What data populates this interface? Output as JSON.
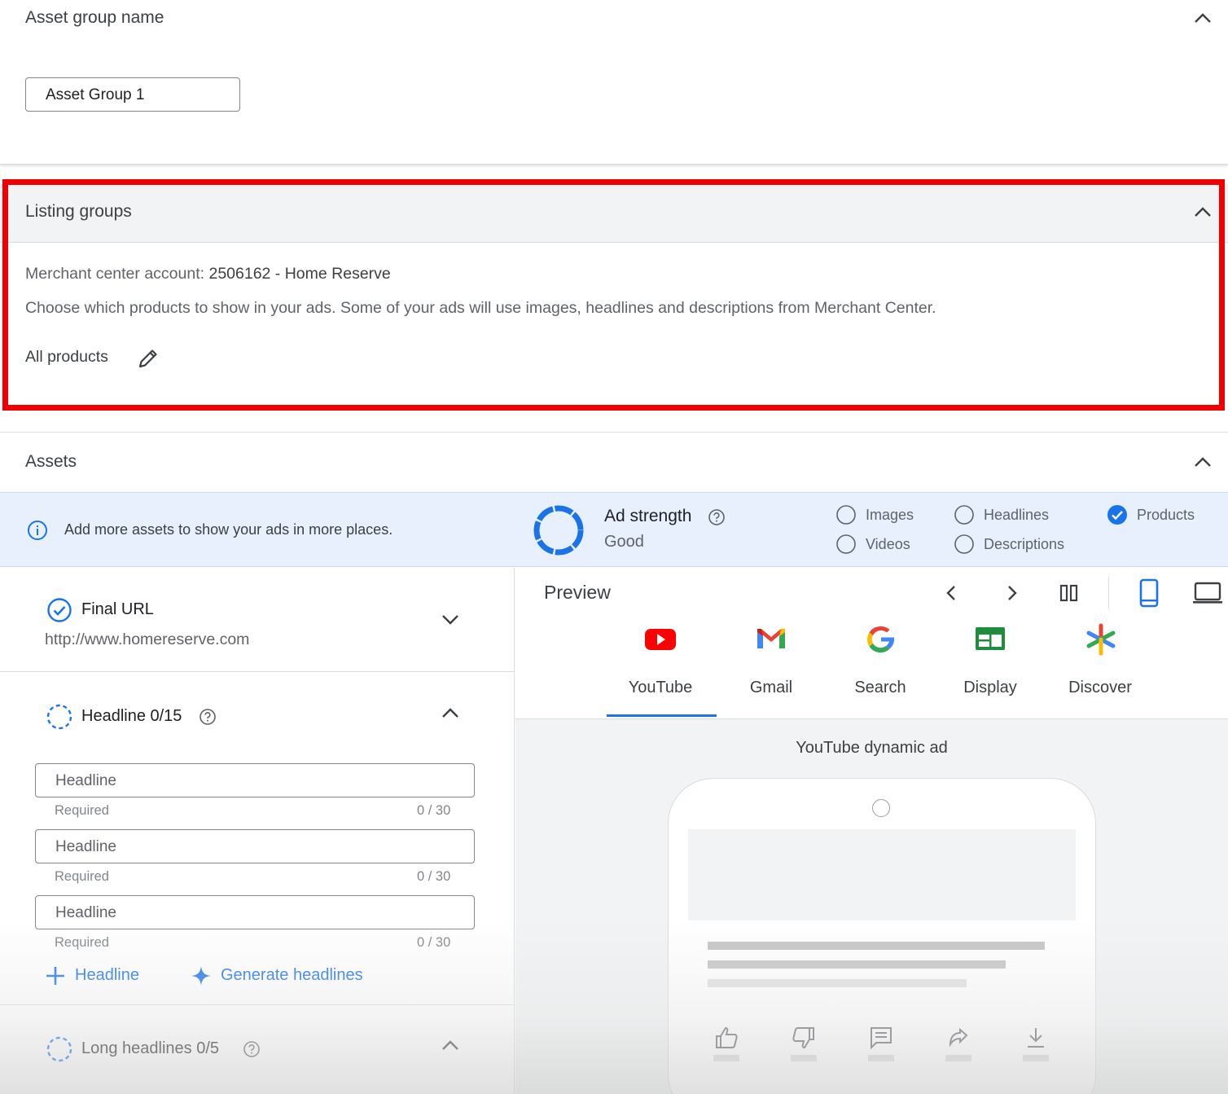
{
  "asset_group_section": {
    "title": "Asset group name",
    "input_value": "Asset Group 1"
  },
  "listing_groups": {
    "title": "Listing groups",
    "merchant_label": "Merchant center account:",
    "merchant_value": "2506162 - Home Reserve",
    "description": "Choose which products to show in your ads. Some of your ads will use images, headlines and descriptions from Merchant Center.",
    "filter_label": "All products",
    "highlight_color": "#f00000"
  },
  "assets": {
    "title": "Assets",
    "banner_text": "Add more assets to show your ads in more places.",
    "ad_strength_label": "Ad strength",
    "ad_strength_value": "Good",
    "checklist": [
      {
        "label": "Images",
        "checked": false
      },
      {
        "label": "Headlines",
        "checked": false
      },
      {
        "label": "Products",
        "checked": true
      },
      {
        "label": "Videos",
        "checked": false
      },
      {
        "label": "Descriptions",
        "checked": false
      }
    ],
    "final_url": {
      "title": "Final URL",
      "value": "http://www.homereserve.com"
    },
    "headline": {
      "title": "Headline 0/15",
      "fields": [
        {
          "placeholder": "Headline",
          "helper": "Required",
          "count": "0 / 30"
        },
        {
          "placeholder": "Headline",
          "helper": "Required",
          "count": "0 / 30"
        },
        {
          "placeholder": "Headline",
          "helper": "Required",
          "count": "0 / 30"
        }
      ],
      "add_label": "Headline",
      "generate_label": "Generate headlines"
    },
    "long_headlines": {
      "title": "Long headlines 0/5"
    }
  },
  "preview": {
    "title": "Preview",
    "tabs": [
      "YouTube",
      "Gmail",
      "Search",
      "Display",
      "Discover"
    ],
    "active_tab": "YouTube",
    "ad_title": "YouTube dynamic ad"
  },
  "colors": {
    "accent": "#1a73e8",
    "banner_bg": "#e8f0fe",
    "youtube_red": "#ff0000"
  }
}
